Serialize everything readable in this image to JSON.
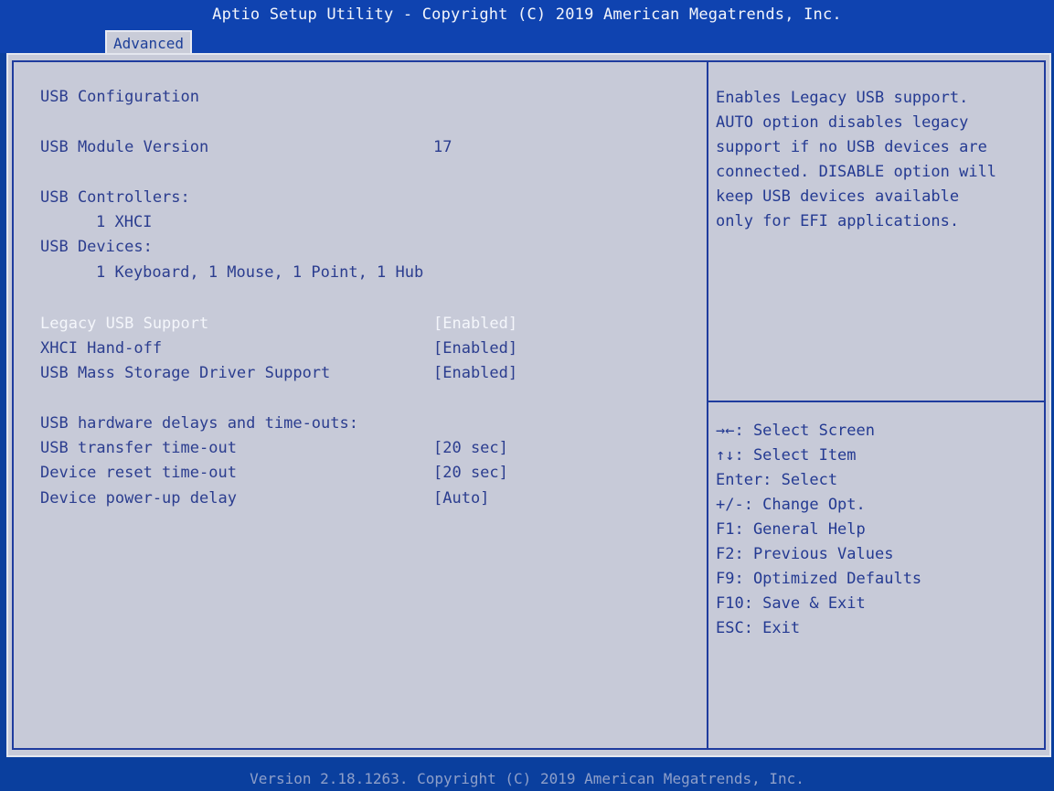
{
  "header": {
    "title": "Aptio Setup Utility - Copyright (C) 2019 American Megatrends, Inc.",
    "active_tab": "Advanced"
  },
  "main": {
    "section_title": "USB Configuration",
    "module_version_label": "USB Module Version",
    "module_version_value": "17",
    "controllers_label": "USB Controllers:",
    "controllers_value": "1 XHCI",
    "devices_label": "USB Devices:",
    "devices_value": "1 Keyboard, 1 Mouse, 1 Point, 1 Hub",
    "settings": [
      {
        "label": "Legacy USB Support",
        "value": "[Enabled]",
        "selected": true
      },
      {
        "label": "XHCI Hand-off",
        "value": "[Enabled]",
        "selected": false
      },
      {
        "label": "USB Mass Storage Driver Support",
        "value": "[Enabled]",
        "selected": false
      }
    ],
    "delays_heading": "USB hardware delays and time-outs:",
    "delays": [
      {
        "label": "USB transfer time-out",
        "value": "[20 sec]"
      },
      {
        "label": "Device reset time-out",
        "value": "[20 sec]"
      },
      {
        "label": "Device power-up delay",
        "value": "[Auto]"
      }
    ]
  },
  "help": {
    "description": [
      "Enables Legacy USB support.",
      "AUTO option disables legacy",
      "support if no USB devices are",
      "connected. DISABLE option will",
      "keep USB devices available",
      "only for EFI applications."
    ],
    "keys": [
      "→←: Select Screen",
      "↑↓: Select Item",
      "Enter: Select",
      "+/-: Change Opt.",
      "F1: General Help",
      "F2: Previous Values",
      "F9: Optimized Defaults",
      "F10: Save & Exit",
      "ESC: Exit"
    ]
  },
  "footer": {
    "text": "Version 2.18.1263. Copyright (C) 2019 American Megatrends, Inc."
  },
  "colors": {
    "header_bg": "#0f43b0",
    "panel_bg": "#c7cad8",
    "text": "#2b3d8f",
    "selected_text": "#f4f6fb",
    "border": "#1f3c9e"
  }
}
